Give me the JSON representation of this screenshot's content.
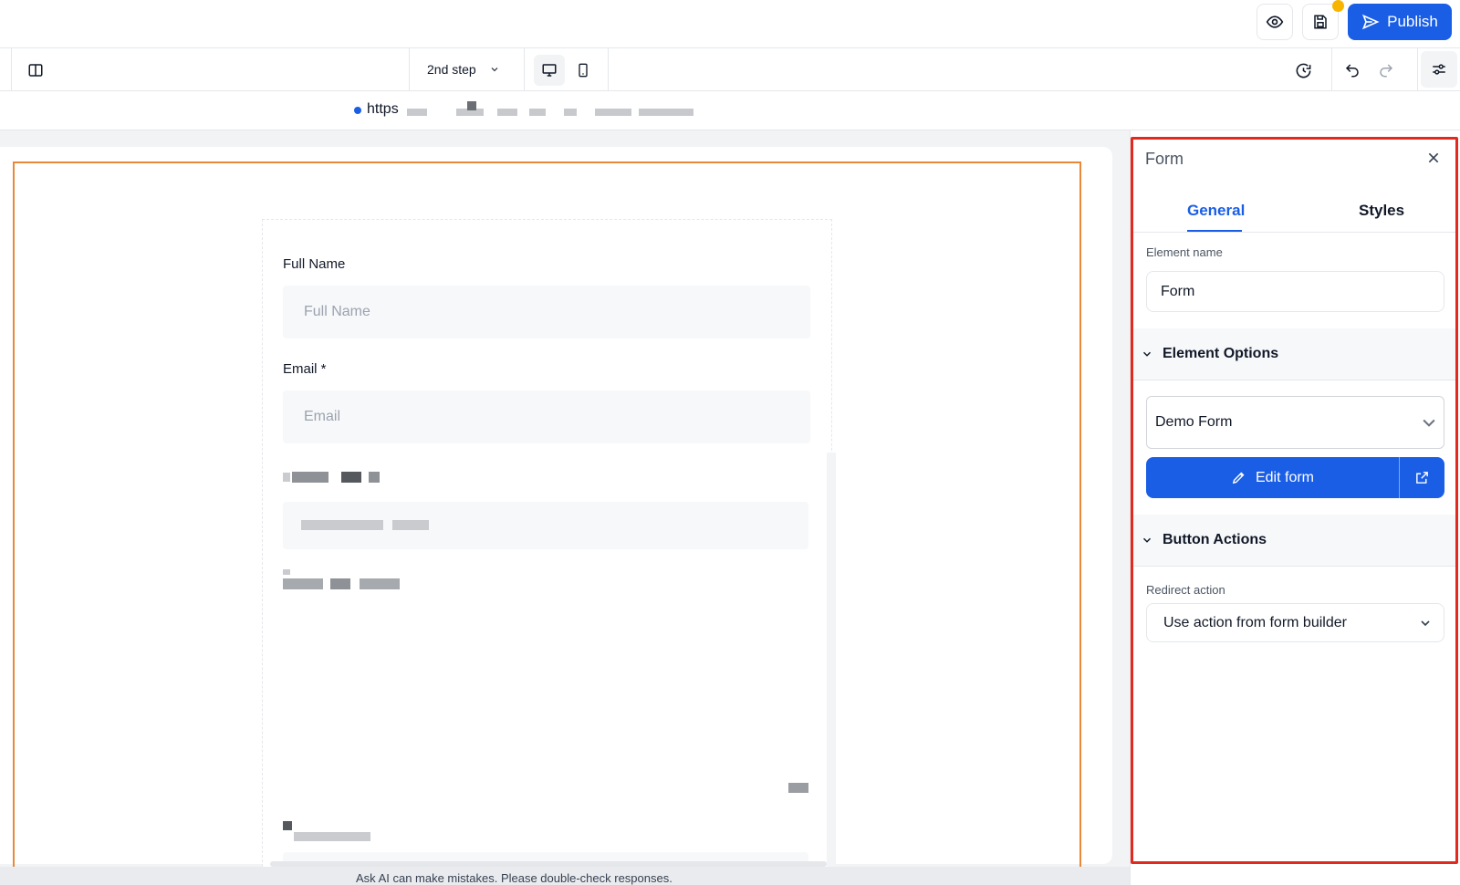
{
  "header": {
    "publish_label": "Publish"
  },
  "toolbar": {
    "step_label": "2nd step"
  },
  "urlbar": {
    "url_prefix": "https"
  },
  "form_preview": {
    "fields": [
      {
        "label": "Full Name",
        "placeholder": "Full Name"
      },
      {
        "label": "Email *",
        "placeholder": "Email"
      }
    ]
  },
  "footer": {
    "disclaimer": "Ask AI can make mistakes. Please double-check responses."
  },
  "panel": {
    "title": "Form",
    "tabs": [
      {
        "label": "General",
        "active": true
      },
      {
        "label": "Styles",
        "active": false
      }
    ],
    "element_name_label": "Element name",
    "element_name_value": "Form",
    "element_options_title": "Element Options",
    "form_select_value": "Demo Form",
    "edit_form_label": "Edit form",
    "button_actions_title": "Button Actions",
    "redirect_label": "Redirect action",
    "redirect_value": "Use action from form builder"
  },
  "colors": {
    "accent": "#1a5ee6",
    "selection_outline": "#e8893a",
    "panel_highlight": "#e02a1f",
    "notification": "#f7b500"
  },
  "icons": [
    "eye-icon",
    "save-icon",
    "send-icon",
    "sidebar-toggle-icon",
    "chevron-down-icon",
    "desktop-icon",
    "mobile-icon",
    "history-icon",
    "undo-icon",
    "redo-icon",
    "settings-sliders-icon",
    "close-icon",
    "pencil-icon",
    "external-link-icon"
  ]
}
